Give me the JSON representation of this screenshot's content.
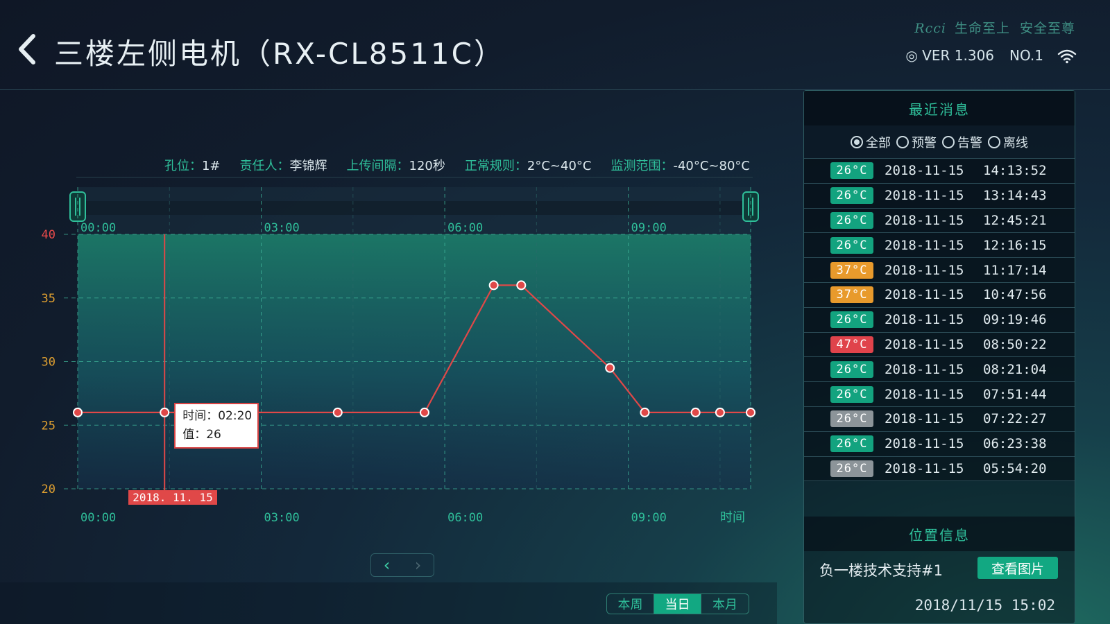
{
  "header": {
    "title": "三楼左侧电机（RX-CL8511C）",
    "brand_logo": "Rcci",
    "slogan_1": "生命至上",
    "slogan_2": "安全至尊",
    "version": "◎ VER 1.306",
    "number": "NO.1"
  },
  "info": {
    "hole_label": "孔位：",
    "hole_value": "1#",
    "owner_label": "责任人：",
    "owner_value": "李锦辉",
    "interval_label": "上传间隔：",
    "interval_value": "120秒",
    "rule_label": "正常规则：",
    "rule_value": "2°C~40°C",
    "range_label": "监测范围：",
    "range_value": "-40°C~80°C"
  },
  "chart_data": {
    "type": "line",
    "x_unit": "hours",
    "x_ticks": [
      "00:00",
      "03:00",
      "06:00",
      "09:00"
    ],
    "xlabel": "时间",
    "ylim": [
      20,
      40
    ],
    "y_ticks": [
      40,
      35,
      30,
      25,
      20
    ],
    "xlim": [
      0,
      11
    ],
    "series": [
      {
        "x": [
          0,
          1.42,
          4.25,
          5.67,
          6.8,
          7.25,
          8.7,
          9.27,
          10.1,
          10.5,
          11.0
        ],
        "values": [
          26,
          26,
          26,
          26,
          36,
          36,
          29.5,
          26,
          26,
          26,
          26
        ]
      }
    ],
    "grid": true,
    "tooltip": {
      "time_label": "时间：",
      "time_value": "02:20",
      "value_label": "值：",
      "value_value": "26"
    },
    "date_marker": "2018. 11. 15"
  },
  "pager": {
    "prev": "‹",
    "next": "›"
  },
  "range_tabs": {
    "week": "本周",
    "day": "当日",
    "month": "本月"
  },
  "messages": {
    "title": "最近消息",
    "filters": [
      "全部",
      "预警",
      "告警",
      "离线"
    ],
    "rows": [
      {
        "temp": "26°C",
        "date": "2018-11-15",
        "time": "14:13:52",
        "color": "#13a37f"
      },
      {
        "temp": "26°C",
        "date": "2018-11-15",
        "time": "13:14:43",
        "color": "#13a37f"
      },
      {
        "temp": "26°C",
        "date": "2018-11-15",
        "time": "12:45:21",
        "color": "#13a37f"
      },
      {
        "temp": "26°C",
        "date": "2018-11-15",
        "time": "12:16:15",
        "color": "#13a37f"
      },
      {
        "temp": "37°C",
        "date": "2018-11-15",
        "time": "11:17:14",
        "color": "#e89a2c"
      },
      {
        "temp": "37°C",
        "date": "2018-11-15",
        "time": "10:47:56",
        "color": "#e89a2c"
      },
      {
        "temp": "26°C",
        "date": "2018-11-15",
        "time": "09:19:46",
        "color": "#13a37f"
      },
      {
        "temp": "47°C",
        "date": "2018-11-15",
        "time": "08:50:22",
        "color": "#e0434b"
      },
      {
        "temp": "26°C",
        "date": "2018-11-15",
        "time": "08:21:04",
        "color": "#13a37f"
      },
      {
        "temp": "26°C",
        "date": "2018-11-15",
        "time": "07:51:44",
        "color": "#13a37f"
      },
      {
        "temp": "26°C",
        "date": "2018-11-15",
        "time": "07:22:27",
        "color": "#8c9499"
      },
      {
        "temp": "26°C",
        "date": "2018-11-15",
        "time": "06:23:38",
        "color": "#13a37f"
      },
      {
        "temp": "26°C",
        "date": "2018-11-15",
        "time": "05:54:20",
        "color": "#8c9499"
      }
    ]
  },
  "location": {
    "title": "位置信息",
    "name": "负一楼技术支持#1",
    "view_button": "查看图片",
    "datetime": "2018/11/15  15:02"
  },
  "colors": {
    "accent": "#2fbf9a",
    "line": "#e04848"
  }
}
